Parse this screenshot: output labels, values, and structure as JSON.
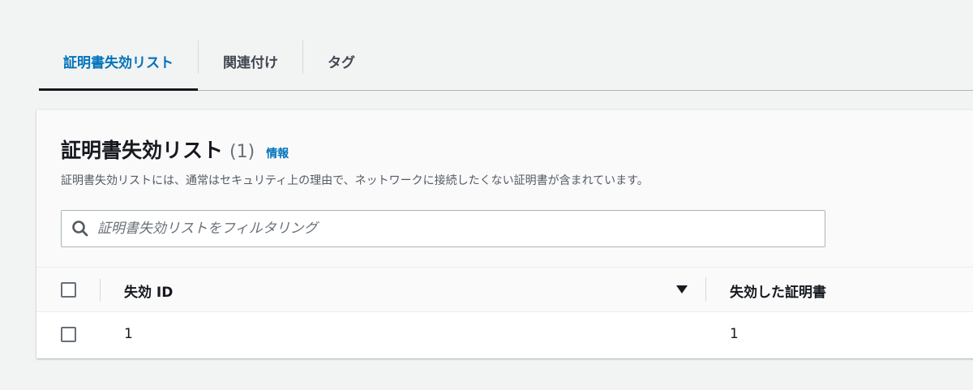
{
  "tabs": [
    {
      "label": "証明書失効リスト",
      "active": true
    },
    {
      "label": "関連付け",
      "active": false
    },
    {
      "label": "タグ",
      "active": false
    }
  ],
  "panel": {
    "title": "証明書失効リスト",
    "count": "(1)",
    "info_link": "情報",
    "description": "証明書失効リストには、通常はセキュリティ上の理由で、ネットワークに接続したくない証明書が含まれています。"
  },
  "search": {
    "placeholder": "証明書失効リストをフィルタリング",
    "value": ""
  },
  "table": {
    "columns": [
      "失効 ID",
      "失効した証明書"
    ],
    "sorted_column": "失効 ID",
    "sort_direction": "descending",
    "rows": [
      {
        "revocation_id": "1",
        "revoked_certificate": "1"
      }
    ]
  },
  "colors": {
    "accent": "#0073bb",
    "background": "#f2f3f3",
    "text": "#16191f"
  }
}
